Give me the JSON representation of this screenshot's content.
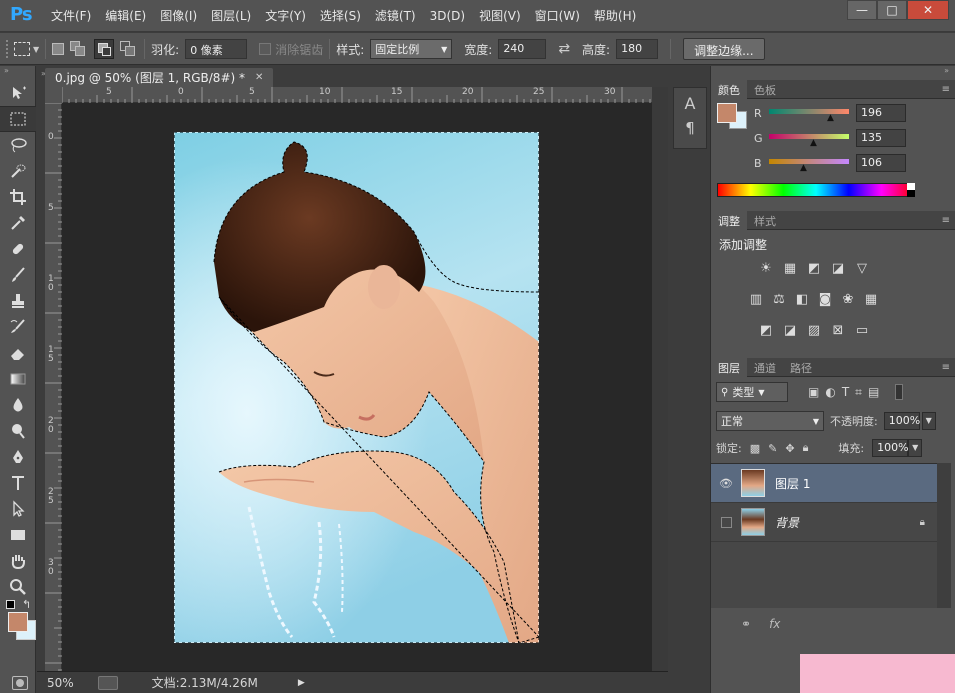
{
  "app": {
    "logo": "Ps"
  },
  "menu": [
    "文件(F)",
    "编辑(E)",
    "图像(I)",
    "图层(L)",
    "文字(Y)",
    "选择(S)",
    "滤镜(T)",
    "3D(D)",
    "视图(V)",
    "窗口(W)",
    "帮助(H)"
  ],
  "window_controls": {
    "minimize": "—",
    "maximize": "□",
    "close": "✕"
  },
  "options": {
    "feather_label": "羽化:",
    "feather_value": "0 像素",
    "antialias_label": "消除锯齿",
    "style_label": "样式:",
    "style_value": "固定比例",
    "width_label": "宽度:",
    "width_value": "240",
    "height_label": "高度:",
    "height_value": "180",
    "refine_edge": "调整边缘..."
  },
  "document": {
    "tab_title": "0.jpg @ 50% (图层 1, RGB/8#) *",
    "ruler_top": [
      "5",
      "0",
      "5",
      "10",
      "15",
      "20",
      "25",
      "30"
    ],
    "ruler_left": [
      "0",
      "5",
      "1\n0",
      "1\n5",
      "2\n0",
      "2\n5",
      "3\n0"
    ],
    "zoom": "50%",
    "doc_info": "文档:2.13M/4.26M"
  },
  "color_panel": {
    "tabs": [
      "颜色",
      "色板"
    ],
    "r_label": "R",
    "r_value": "196",
    "g_label": "G",
    "g_value": "135",
    "b_label": "B",
    "b_value": "106",
    "foreground": "#c4876a",
    "background": "#ddf1fa"
  },
  "adjustments_panel": {
    "tabs": [
      "调整",
      "样式"
    ],
    "title": "添加调整"
  },
  "layers_panel": {
    "tabs": [
      "图层",
      "通道",
      "路径"
    ],
    "filter_kind": "类型",
    "blend_mode": "正常",
    "opacity_label": "不透明度:",
    "opacity_value": "100%",
    "lock_label": "锁定:",
    "fill_label": "填充:",
    "fill_value": "100%",
    "layers": [
      {
        "name": "图层 1",
        "visible": true,
        "selected": true
      },
      {
        "name": "背景",
        "visible": false,
        "locked": true
      }
    ],
    "footer_icons": [
      "link-icon",
      "fx-icon"
    ]
  }
}
